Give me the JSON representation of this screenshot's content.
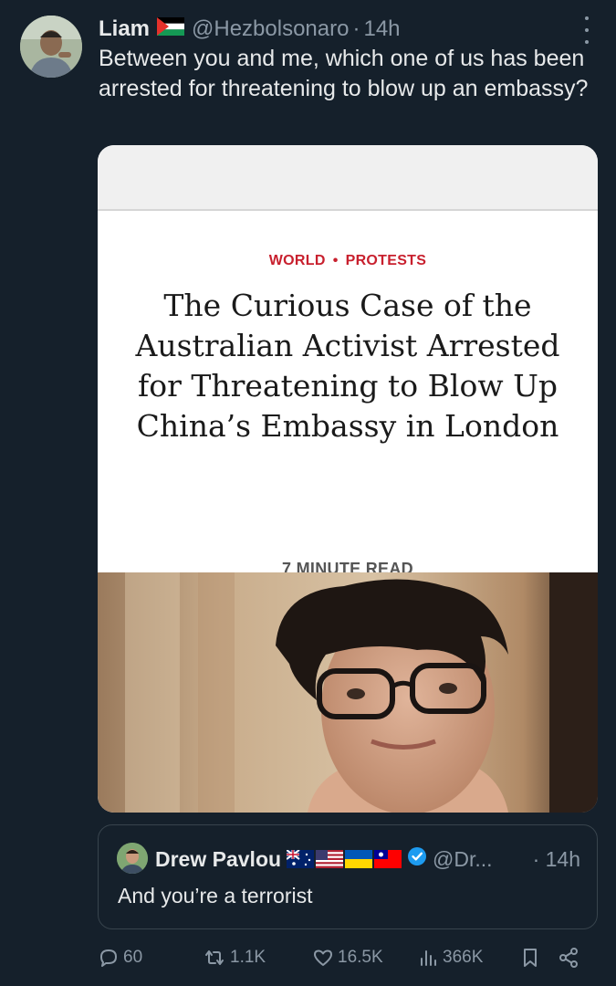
{
  "tweet": {
    "author_name": "Liam",
    "author_handle": "@Hezbolsonaro",
    "separator": "·",
    "time": "14h",
    "text": "Between you and me, which one of us has been arrested for threatening to blow up an embassy?",
    "more_icon": "more-vertical-icon"
  },
  "card": {
    "category_1": "WORLD",
    "category_bullet": "•",
    "category_2": "PROTESTS",
    "headline": "The Curious Case of the Australian Activist Arrested for Threatening to Blow Up China’s Embassy in London",
    "read_time": "7 MINUTE READ"
  },
  "quote": {
    "author_name": "Drew Pavlou",
    "author_handle": "@Dr...",
    "time": "· 14h",
    "text": "And you’re a terrorist",
    "badge_icon": "verified-badge-icon"
  },
  "actions": {
    "replies": "60",
    "reposts": "1.1K",
    "likes": "16.5K",
    "views": "366K"
  },
  "colors": {
    "background": "#15202b",
    "primary_text": "#e7e9ea",
    "secondary_text": "#8b98a5",
    "accent_red": "#c8202e",
    "verified_blue": "#1d9bf0"
  }
}
